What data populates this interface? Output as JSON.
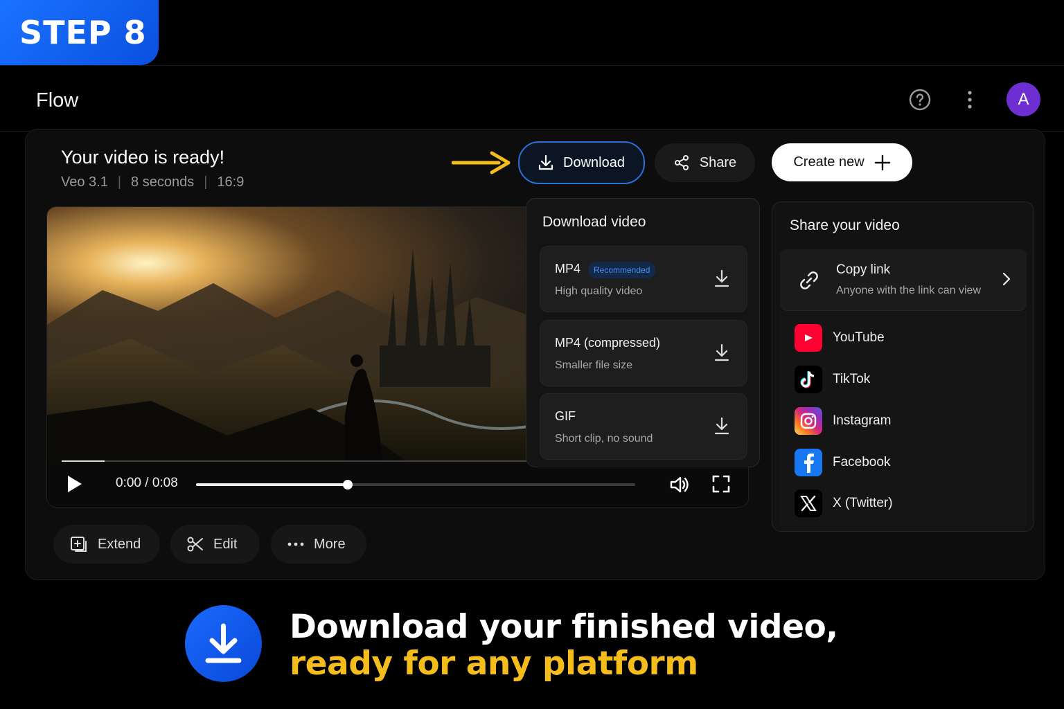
{
  "step_badge": "STEP 8",
  "app": {
    "title": "Flow",
    "avatar_letter": "A"
  },
  "video": {
    "title": "Your video is ready!",
    "model": "Veo 3.1",
    "duration": "8 seconds",
    "aspect": "16:9",
    "separator": "|",
    "time": "0:00 / 0:08",
    "scrub_progress": 0.345,
    "buffer_progress": 0.064
  },
  "toolbar": {
    "download_label": "Download",
    "share_label": "Share",
    "create_label": "Create new"
  },
  "actions": {
    "extend": "Extend",
    "edit": "Edit",
    "more": "More"
  },
  "download_panel": {
    "title": "Download video",
    "options": [
      {
        "name": "MP4",
        "badge": "Recommended",
        "desc": "High quality video"
      },
      {
        "name": "MP4 (compressed)",
        "desc": "Smaller file size"
      },
      {
        "name": "GIF",
        "desc": "Short clip, no sound"
      }
    ]
  },
  "share_panel": {
    "title": "Share your video",
    "copy_label": "Copy link",
    "copy_desc": "Anyone with the link can view",
    "platforms": [
      {
        "label": "YouTube",
        "icon": "youtube-icon"
      },
      {
        "label": "TikTok",
        "icon": "tiktok-icon"
      },
      {
        "label": "Instagram",
        "icon": "instagram-icon"
      },
      {
        "label": "Facebook",
        "icon": "facebook-icon"
      },
      {
        "label": "X (Twitter)",
        "icon": "x-icon"
      }
    ]
  },
  "footer": {
    "line1": "Download your finished video,",
    "line2": "ready for any platform"
  },
  "colors": {
    "accent": "#1a6bff",
    "highlight": "#f5bd1b",
    "avatar": "#6d2fd1"
  }
}
